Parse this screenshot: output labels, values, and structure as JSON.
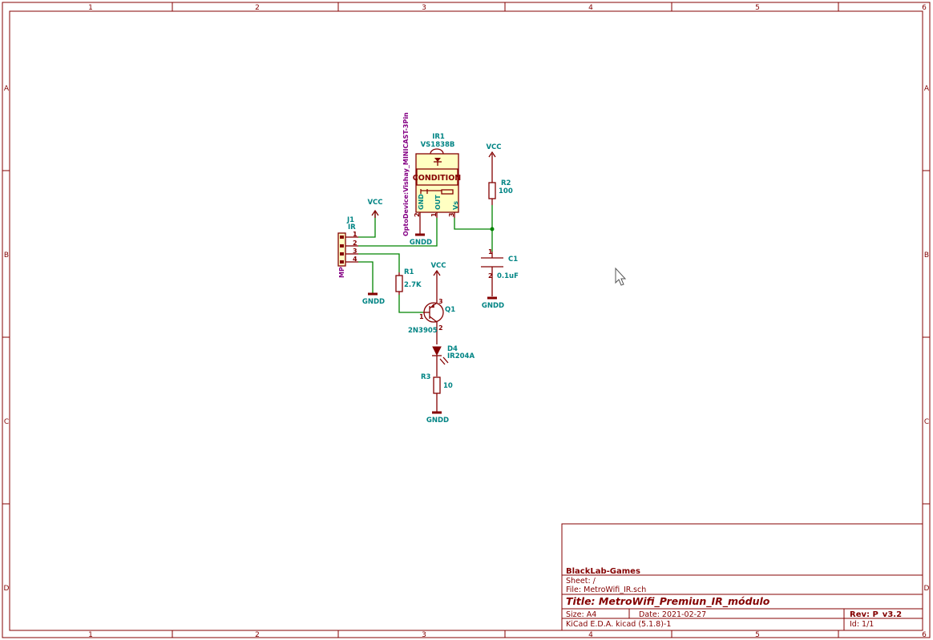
{
  "frame": {
    "columns": [
      "1",
      "2",
      "3",
      "4",
      "5",
      "6"
    ],
    "rows": [
      "A",
      "B",
      "C",
      "D"
    ]
  },
  "components": {
    "ir1": {
      "ref": "IR1",
      "value": "VS1838B",
      "footprint": "OptoDevice:Vishay_MINICAST-3Pin",
      "inner_label": "CONDITION",
      "pins": [
        {
          "num": "2",
          "name": "GND"
        },
        {
          "num": "1",
          "name": "OUT"
        },
        {
          "num": "3",
          "name": "Vs"
        }
      ]
    },
    "j1": {
      "ref": "J1",
      "value": "IR",
      "label": "MP",
      "pins": [
        "1",
        "2",
        "3",
        "4"
      ]
    },
    "r1": {
      "ref": "R1",
      "value": "2.7K"
    },
    "r2": {
      "ref": "R2",
      "value": "100"
    },
    "r3": {
      "ref": "R3",
      "value": "10"
    },
    "c1": {
      "ref": "C1",
      "value": "0.1uF",
      "pins": [
        "1",
        "2"
      ]
    },
    "q1": {
      "ref": "Q1",
      "value": "2N3905",
      "pins": [
        "1",
        "2",
        "3"
      ]
    },
    "d4": {
      "ref": "D4",
      "value": "IR204A"
    }
  },
  "power": {
    "vcc": "VCC",
    "gndd": "GNDD"
  },
  "title_block": {
    "company": "BlackLab-Games",
    "sheet": "Sheet: /",
    "file": "File: MetroWifi_IR.sch",
    "title": "Title: MetroWifi_Premiun_IR_módulo",
    "size": "Size: A4",
    "date": "Date: 2021-02-27",
    "rev": "Rev: P_v3.2",
    "tool": "KiCad E.D.A.  kicad (5.1.8)-1",
    "id": "Id: 1/1"
  }
}
